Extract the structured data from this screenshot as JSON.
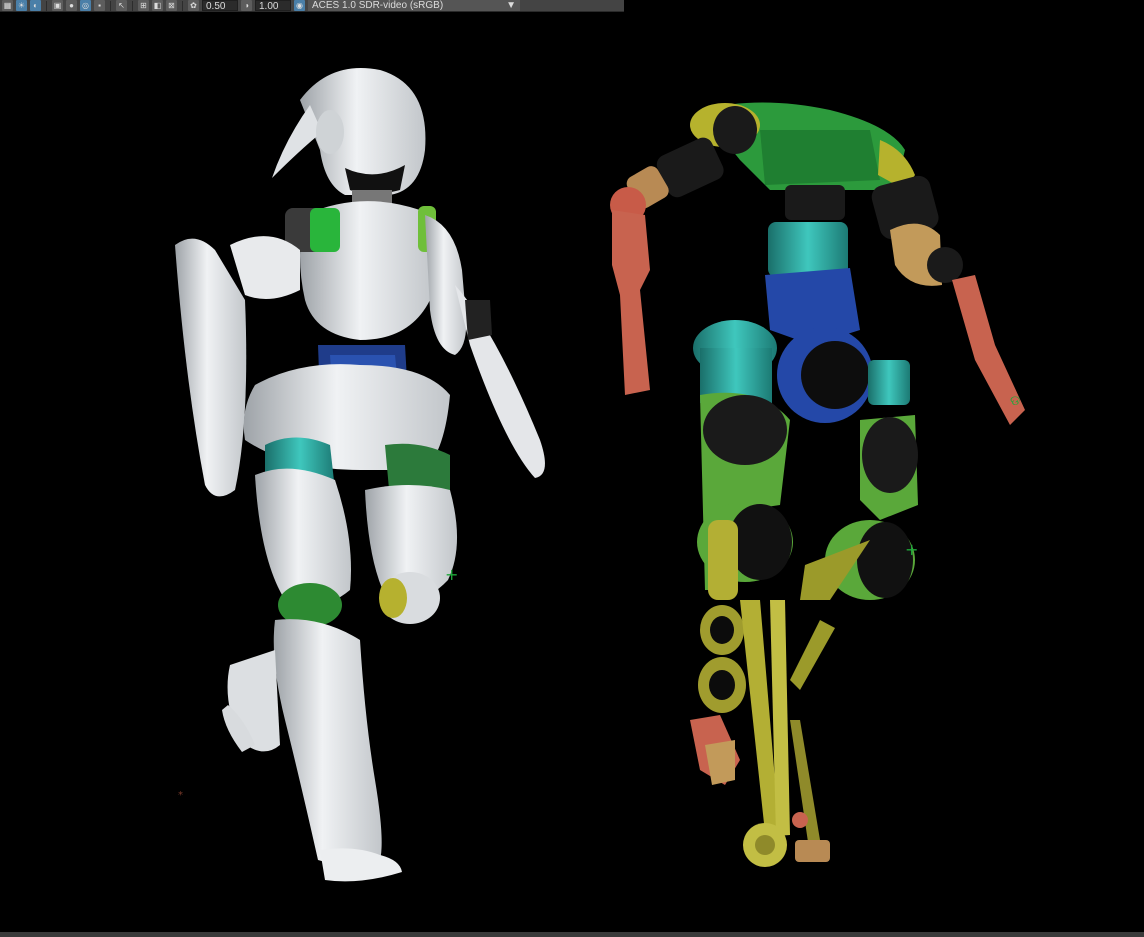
{
  "toolbar": {
    "exposure_value": "0.50",
    "gamma_value": "1.00",
    "color_space": "ACES 1.0 SDR-video (sRGB)",
    "icons": [
      "grid-icon",
      "light-icon",
      "shaded-icon",
      "textured-icon",
      "isolate-icon",
      "xray-icon",
      "select-icon",
      "snap-icon",
      "camera-icon",
      "exposure-icon",
      "gamma-icon",
      "color-management-icon",
      "dropdown-arrow-icon"
    ]
  },
  "viewport": {
    "background": "#000000",
    "models": [
      "shelled-humanoid-robot",
      "exposed-mechanical-robot"
    ]
  }
}
